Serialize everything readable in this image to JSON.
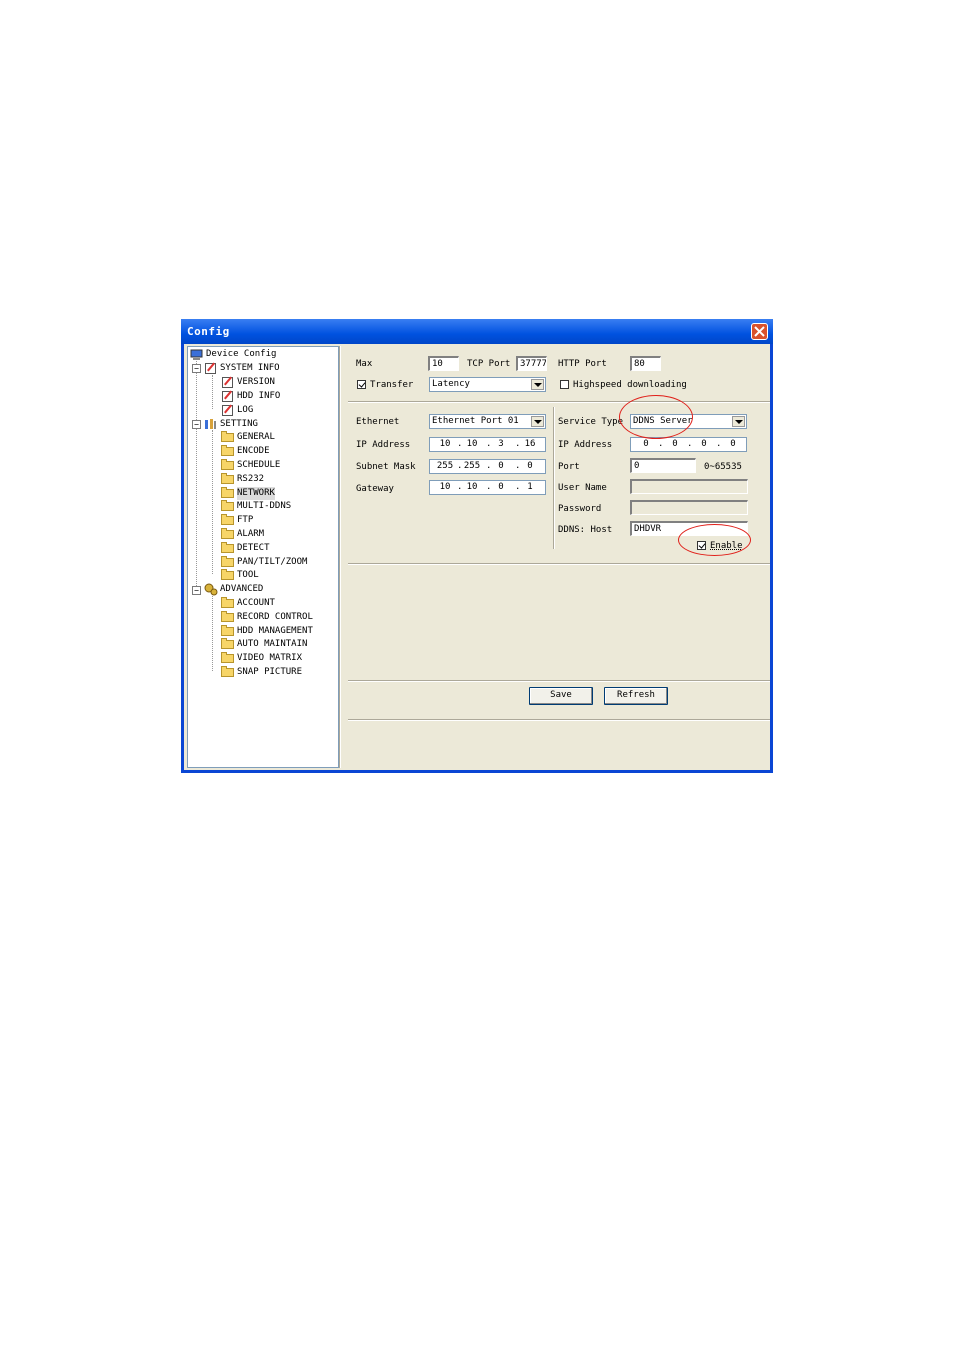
{
  "window": {
    "title": "Config"
  },
  "tree": {
    "root": "Device Config",
    "system_info": {
      "label": "SYSTEM INFO",
      "children": [
        "VERSION",
        "HDD INFO",
        "LOG"
      ]
    },
    "setting": {
      "label": "SETTING",
      "children": [
        "GENERAL",
        "ENCODE",
        "SCHEDULE",
        "RS232",
        "NETWORK",
        "MULTI-DDNS",
        "FTP",
        "ALARM",
        "DETECT",
        "PAN/TILT/ZOOM",
        "TOOL"
      ],
      "selected": "NETWORK"
    },
    "advanced": {
      "label": "ADVANCED",
      "children": [
        "ACCOUNT",
        "RECORD CONTROL",
        "HDD MANAGEMENT",
        "AUTO MAINTAIN",
        "VIDEO MATRIX",
        "SNAP PICTURE"
      ]
    }
  },
  "general": {
    "max_label": "Max",
    "max_value": "10",
    "tcp_port_label": "TCP Port",
    "tcp_port_value": "37777",
    "http_port_label": "HTTP Port",
    "http_port_value": "80",
    "transfer_label": "Transfer",
    "transfer_checked": true,
    "transfer_mode": "Latency",
    "highspeed_label": "Highspeed downloading",
    "highspeed_checked": false
  },
  "ethernet": {
    "ethernet_label": "Ethernet",
    "ethernet_value": "Ethernet Port 01",
    "ip_label": "IP Address",
    "ip": [
      "10",
      "10",
      "3",
      "16"
    ],
    "mask_label": "Subnet Mask",
    "mask": [
      "255",
      "255",
      "0",
      "0"
    ],
    "gateway_label": "Gateway",
    "gateway": [
      "10",
      "10",
      "0",
      "1"
    ]
  },
  "service": {
    "type_label": "Service Type",
    "type_value": "DDNS Server",
    "ip_label": "IP Address",
    "ip": [
      "0",
      "0",
      "0",
      "0"
    ],
    "port_label": "Port",
    "port_value": "0",
    "port_range": "0~65535",
    "user_label": "User Name",
    "user_value": "",
    "password_label": "Password",
    "password_value": "",
    "host_label": "DDNS: Host",
    "host_value": "DHDVR",
    "enable_label": "Enable",
    "enable_checked": true
  },
  "buttons": {
    "save": "Save",
    "refresh": "Refresh"
  },
  "colors": {
    "annotation": "#e0201a",
    "titlebar": "#0052e0",
    "panel": "#ece9d8"
  }
}
